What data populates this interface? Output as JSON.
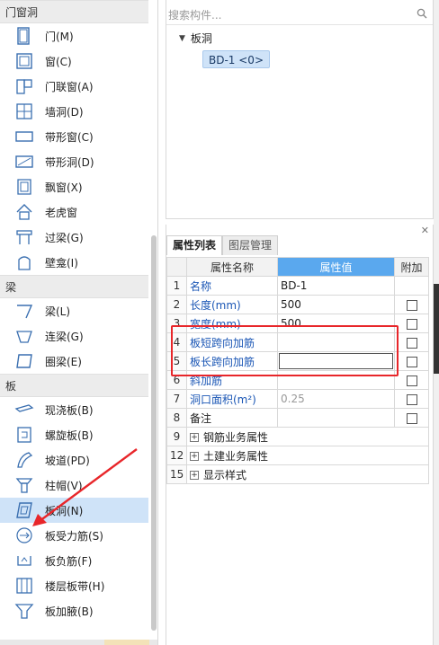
{
  "component_panel": {
    "categories": [
      {
        "label": "门窗洞",
        "items": [
          {
            "label": "门(M)",
            "icon": "door-icon"
          },
          {
            "label": "窗(C)",
            "icon": "window-icon"
          },
          {
            "label": "门联窗(A)",
            "icon": "door-window-icon"
          },
          {
            "label": "墙洞(D)",
            "icon": "wall-opening-icon"
          },
          {
            "label": "带形窗(C)",
            "icon": "strip-window-icon"
          },
          {
            "label": "带形洞(D)",
            "icon": "strip-opening-icon"
          },
          {
            "label": "飘窗(X)",
            "icon": "bay-window-icon"
          },
          {
            "label": "老虎窗",
            "icon": "dormer-icon"
          },
          {
            "label": "过梁(G)",
            "icon": "lintel-icon"
          },
          {
            "label": "壁龛(I)",
            "icon": "niche-icon"
          }
        ]
      },
      {
        "label": "梁",
        "items": [
          {
            "label": "梁(L)",
            "icon": "beam-icon"
          },
          {
            "label": "连梁(G)",
            "icon": "coupling-beam-icon"
          },
          {
            "label": "圈梁(E)",
            "icon": "ring-beam-icon"
          }
        ]
      },
      {
        "label": "板",
        "items": [
          {
            "label": "现浇板(B)",
            "icon": "cast-slab-icon"
          },
          {
            "label": "螺旋板(B)",
            "icon": "spiral-slab-icon"
          },
          {
            "label": "坡道(PD)",
            "icon": "ramp-icon"
          },
          {
            "label": "柱帽(V)",
            "icon": "column-cap-icon"
          },
          {
            "label": "板洞(N)",
            "icon": "slab-hole-icon",
            "selected": true
          },
          {
            "label": "板受力筋(S)",
            "icon": "slab-rebar-icon"
          },
          {
            "label": "板负筋(F)",
            "icon": "negative-rebar-icon"
          },
          {
            "label": "楼层板带(H)",
            "icon": "slab-strip-icon"
          },
          {
            "label": "板加腋(B)",
            "icon": "slab-haunch-icon"
          }
        ]
      }
    ]
  },
  "tree": {
    "search_placeholder": "搜索构件...",
    "root_label": "板洞",
    "leaf_label": "BD-1 <0>"
  },
  "properties": {
    "tabs": [
      "属性列表",
      "图层管理"
    ],
    "headers": [
      "属性名称",
      "属性值",
      "附加"
    ],
    "rows": [
      {
        "num": "1",
        "name": "名称",
        "value": "BD-1",
        "checkbox": false
      },
      {
        "num": "2",
        "name": "长度(mm)",
        "value": "500",
        "checkbox": true
      },
      {
        "num": "3",
        "name": "宽度(mm)",
        "value": "500",
        "checkbox": true
      },
      {
        "num": "4",
        "name": "板短跨向加筋",
        "value": "",
        "checkbox": true
      },
      {
        "num": "5",
        "name": "板长跨向加筋",
        "value": "",
        "checkbox": true,
        "editing": true
      },
      {
        "num": "6",
        "name": "斜加筋",
        "value": "",
        "checkbox": true
      },
      {
        "num": "7",
        "name": "洞口面积(m²)",
        "value": "0.25",
        "checkbox": true
      },
      {
        "num": "8",
        "name": "备注",
        "value": "",
        "checkbox": true
      },
      {
        "num": "9",
        "name": "钢筋业务属性",
        "group": true
      },
      {
        "num": "12",
        "name": "土建业务属性",
        "group": true
      },
      {
        "num": "15",
        "name": "显示样式",
        "group": true
      }
    ]
  },
  "colors": {
    "selected_bg": "#cfe3f8",
    "header_accent": "#5aa8ee",
    "property_link": "#1a56b5",
    "annotation_red": "#e8262a"
  }
}
